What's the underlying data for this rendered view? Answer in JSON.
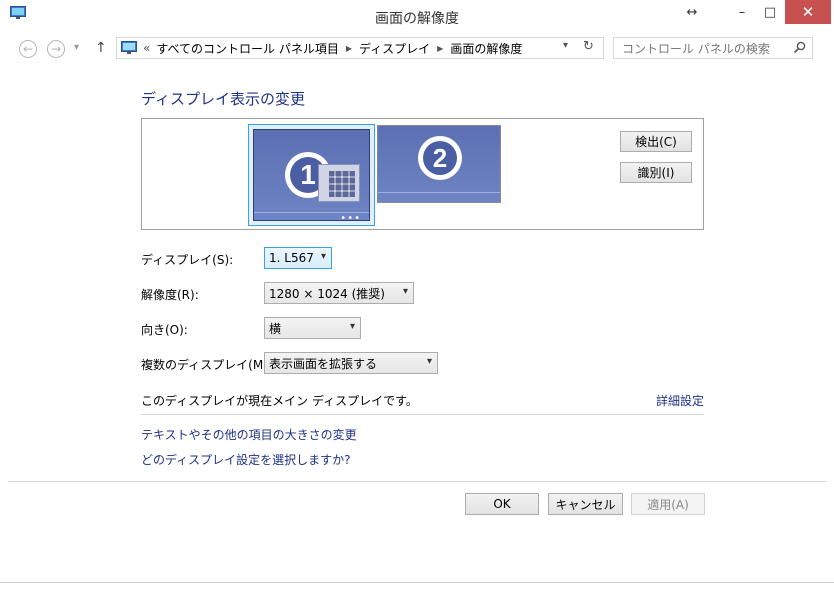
{
  "window": {
    "title": "画面の解像度",
    "resize_glyph": "↔",
    "minimize_glyph": "–",
    "maximize_glyph": "□",
    "close_glyph": "✕"
  },
  "nav": {
    "back_glyph": "←",
    "forward_glyph": "→",
    "recent_glyph": "▾",
    "up_glyph": "↑",
    "overflow": "«",
    "breadcrumbs": [
      "すべてのコントロール パネル項目",
      "ディスプレイ",
      "画面の解像度"
    ],
    "refresh_glyph": "↻",
    "search_placeholder": "コントロール パネルの検索"
  },
  "heading": "ディスプレイ表示の変更",
  "monitors": [
    {
      "number": "1",
      "selected": true
    },
    {
      "number": "2",
      "selected": false
    }
  ],
  "preview_buttons": {
    "detect": "検出(C)",
    "identify": "識別(I)"
  },
  "settings": [
    {
      "label": "ディスプレイ(S):",
      "value": "1. L567"
    },
    {
      "label": "解像度(R):",
      "value": "1280 × 1024 (推奨)"
    },
    {
      "label": "向き(O):",
      "value": "横"
    },
    {
      "label": "複数のディスプレイ(M):",
      "value": "表示画面を拡張する"
    }
  ],
  "status_text": "このディスプレイが現在メイン ディスプレイです。",
  "advanced_link": "詳細設定",
  "links": [
    "テキストやその他の項目の大きさの変更",
    "どのディスプレイ設定を選択しますか?"
  ],
  "footer_buttons": {
    "ok": "OK",
    "cancel": "キャンセル",
    "apply": "適用(A)"
  },
  "colors": {
    "link": "#1e3287",
    "close": "#c75050",
    "monitor": "#6478bc",
    "selection": "#3da0e0"
  }
}
